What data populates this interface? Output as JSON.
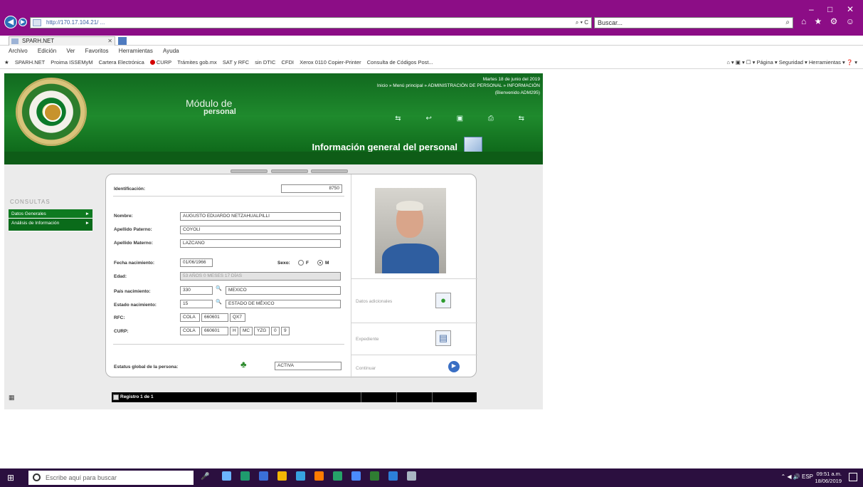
{
  "browser": {
    "address_text": "http://170.17.104.21/ ...",
    "address_tail": "⌕ ▾ C",
    "search_placeholder": "Buscar...",
    "tab_label": "SPARH.NET",
    "window_controls": [
      "–",
      "□",
      "✕"
    ],
    "toolbar_icons": "⌂ ★ ⚙ ☺",
    "menu": [
      "Archivo",
      "Edición",
      "Ver",
      "Favoritos",
      "Herramientas",
      "Ayuda"
    ],
    "favorites": [
      "SPARH.NET",
      "Proima ISSEMyM",
      "Cartera Electrónica",
      "CURP",
      "Trámites gob.mx",
      "SAT y RFC",
      "sin DTIC",
      "CFDI",
      "Xerox 0110 Copier-Printer",
      "Consulta de Códigos Post..."
    ],
    "favbar_right": "⌂ ▾ ▣ ▾ ☐ ▾ Página ▾ Seguridad ▾ Herramientas ▾ ❓ ▾"
  },
  "header": {
    "module_line1": "Módulo de",
    "module_line2": "personal",
    "date": "Martes 18 de junio del 2019",
    "breadcrumb": "Inicio » Menú principal » ADMINISTRACIÓN DE PERSONAL » INFORMACIÓN",
    "user": "(Bienvenido ADM295)",
    "icons": "⇆ ↩ ▣ ⎙ ⇆",
    "page_title": "Información general del personal"
  },
  "sidebar": {
    "label": "CONSULTAS",
    "items": [
      {
        "label": "Datos Generales"
      },
      {
        "label": "Análisis de Información"
      }
    ],
    "arrow": "►"
  },
  "form": {
    "identificacion": {
      "label": "Identificación:",
      "value": "8750"
    },
    "nombre": {
      "label": "Nombre:",
      "value": "AUGUSTO EDUARDO NETZAHUALPILLI"
    },
    "paterno": {
      "label": "Apellido Paterno:",
      "value": "COYOLI"
    },
    "materno": {
      "label": "Apellido Materno:",
      "value": "LAZCANO"
    },
    "nacimiento": {
      "label": "Fecha nacimiento:",
      "value": "01/06/1966"
    },
    "sexo": {
      "label": "Sexo:",
      "options": [
        "F",
        "M"
      ],
      "selected": "M"
    },
    "edad": {
      "label": "Edad:",
      "value": "53 AÑOS 0 MESES 17 DÍAS"
    },
    "pais": {
      "label": "País nacimiento:",
      "code": "330",
      "name": "MEXICO"
    },
    "estado": {
      "label": "Estado nacimiento:",
      "code": "15",
      "name": "ESTADO DE MÉXICO"
    },
    "rfc": {
      "label": "RFC:",
      "parts": [
        "COLA",
        "660601",
        "QX7"
      ]
    },
    "curp": {
      "label": "CURP:",
      "parts": [
        "COLA",
        "660601",
        "H",
        "MC",
        "YZG",
        "0",
        "9"
      ]
    },
    "estatus": {
      "label": "Estatus global de la persona:",
      "value": "ACTIVA"
    },
    "glass": "🔍"
  },
  "right_panel": {
    "datos_adicionales": "Datos adicionales",
    "expediente": "Expediente",
    "continuar": "Continuar",
    "icon_datos": "●",
    "icon_exp": "▤",
    "icon_cont": "▶"
  },
  "footer": {
    "registros": "Registro 1 de 1"
  },
  "taskbar": {
    "search_placeholder": "Escribe aquí para buscar",
    "start_glyph": "⊞",
    "mic_glyph": "🎤",
    "tray": "⌃ ◀ 🔊 ESP",
    "time": "09:51 a.m.",
    "date": "18/06/2019",
    "app_colors": [
      "#6cb5ff",
      "#1f9b6e",
      "#3a6fd8",
      "#f2b705",
      "#37a3e0",
      "#ff7b00",
      "#26a269",
      "#4b8bff",
      "#2f7d32",
      "#2c7fd8",
      "#aab6c3"
    ]
  }
}
